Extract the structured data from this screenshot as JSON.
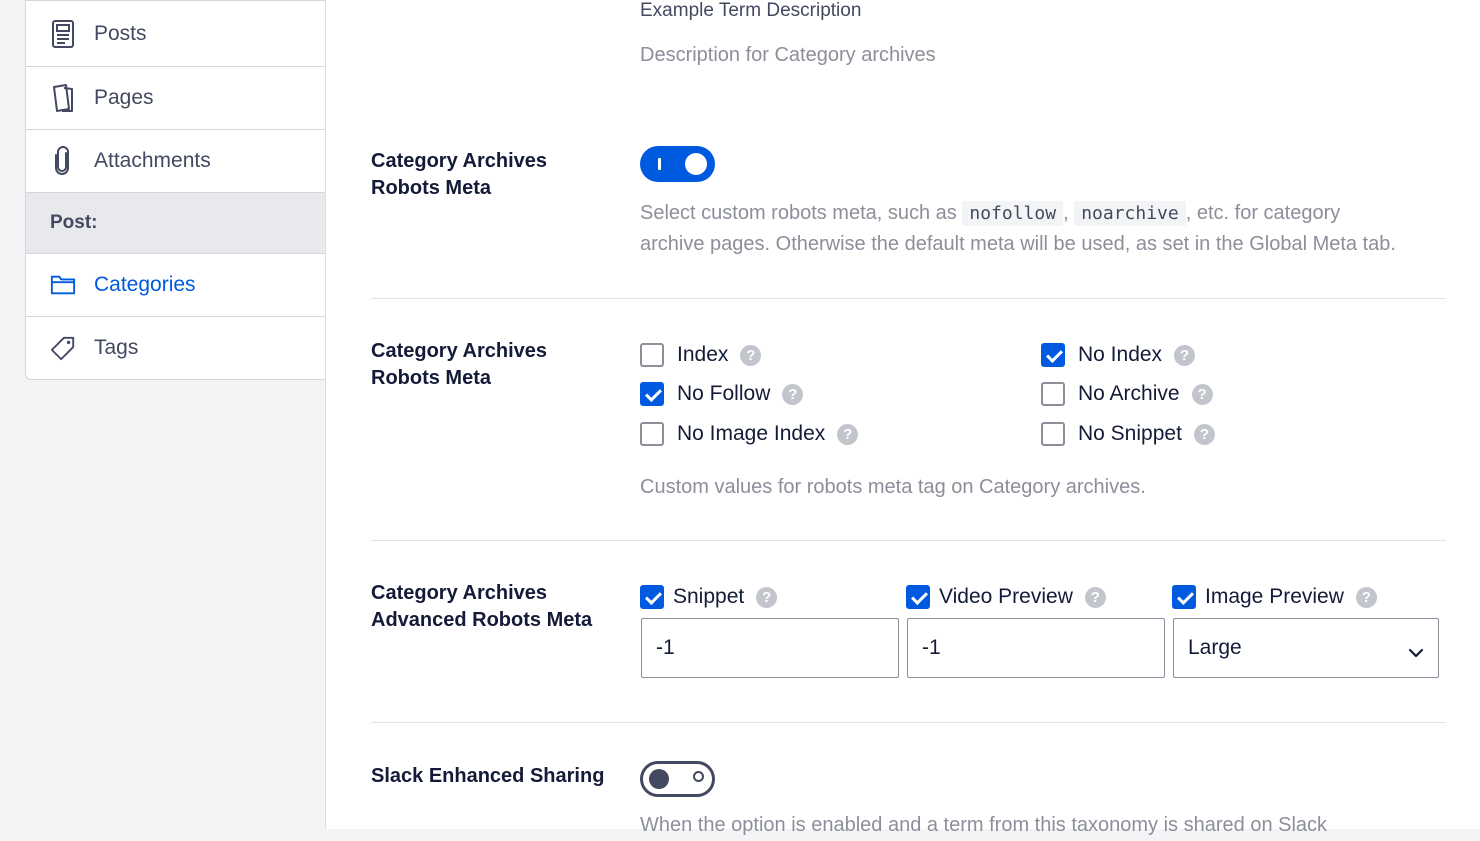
{
  "sidebar": {
    "items": [
      {
        "label": "Posts",
        "icon": "posts-icon"
      },
      {
        "label": "Pages",
        "icon": "pages-icon"
      },
      {
        "label": "Attachments",
        "icon": "attachment-icon"
      }
    ],
    "section_header": "Post:",
    "post_items": [
      {
        "label": "Categories",
        "icon": "folder-icon",
        "active": true
      },
      {
        "label": "Tags",
        "icon": "tag-icon"
      }
    ],
    "accent_color": "#005ae0"
  },
  "description_field": {
    "value": "Example Term Description",
    "help": "Description for Category archives"
  },
  "robots_meta_toggle": {
    "label": "Category Archives Robots Meta",
    "enabled": true,
    "desc_before": "Select custom robots meta, such as",
    "code1": "nofollow",
    "sep": ",",
    "code2": "noarchive",
    "desc_after": ", etc. for category",
    "desc_line2": "archive pages. Otherwise the default meta will be used, as set in the Global Meta tab."
  },
  "robots_meta_options": {
    "label": "Category Archives Robots Meta",
    "options": [
      {
        "label": "Index",
        "checked": false
      },
      {
        "label": "No Index",
        "checked": true
      },
      {
        "label": "No Follow",
        "checked": true
      },
      {
        "label": "No Archive",
        "checked": false
      },
      {
        "label": "No Image Index",
        "checked": false
      },
      {
        "label": "No Snippet",
        "checked": false
      }
    ],
    "help": "Custom values for robots meta tag on Category archives."
  },
  "advanced_robots": {
    "label": "Category Archives Advanced Robots Meta",
    "snippet": {
      "label": "Snippet",
      "checked": true,
      "value": "-1"
    },
    "video_preview": {
      "label": "Video Preview",
      "checked": true,
      "value": "-1"
    },
    "image_preview": {
      "label": "Image Preview",
      "checked": true,
      "value": "Large"
    }
  },
  "slack_sharing": {
    "label": "Slack Enhanced Sharing",
    "enabled": false,
    "help": "When the option is enabled and a term from this taxonomy is shared on Slack"
  },
  "help_glyph": "?"
}
